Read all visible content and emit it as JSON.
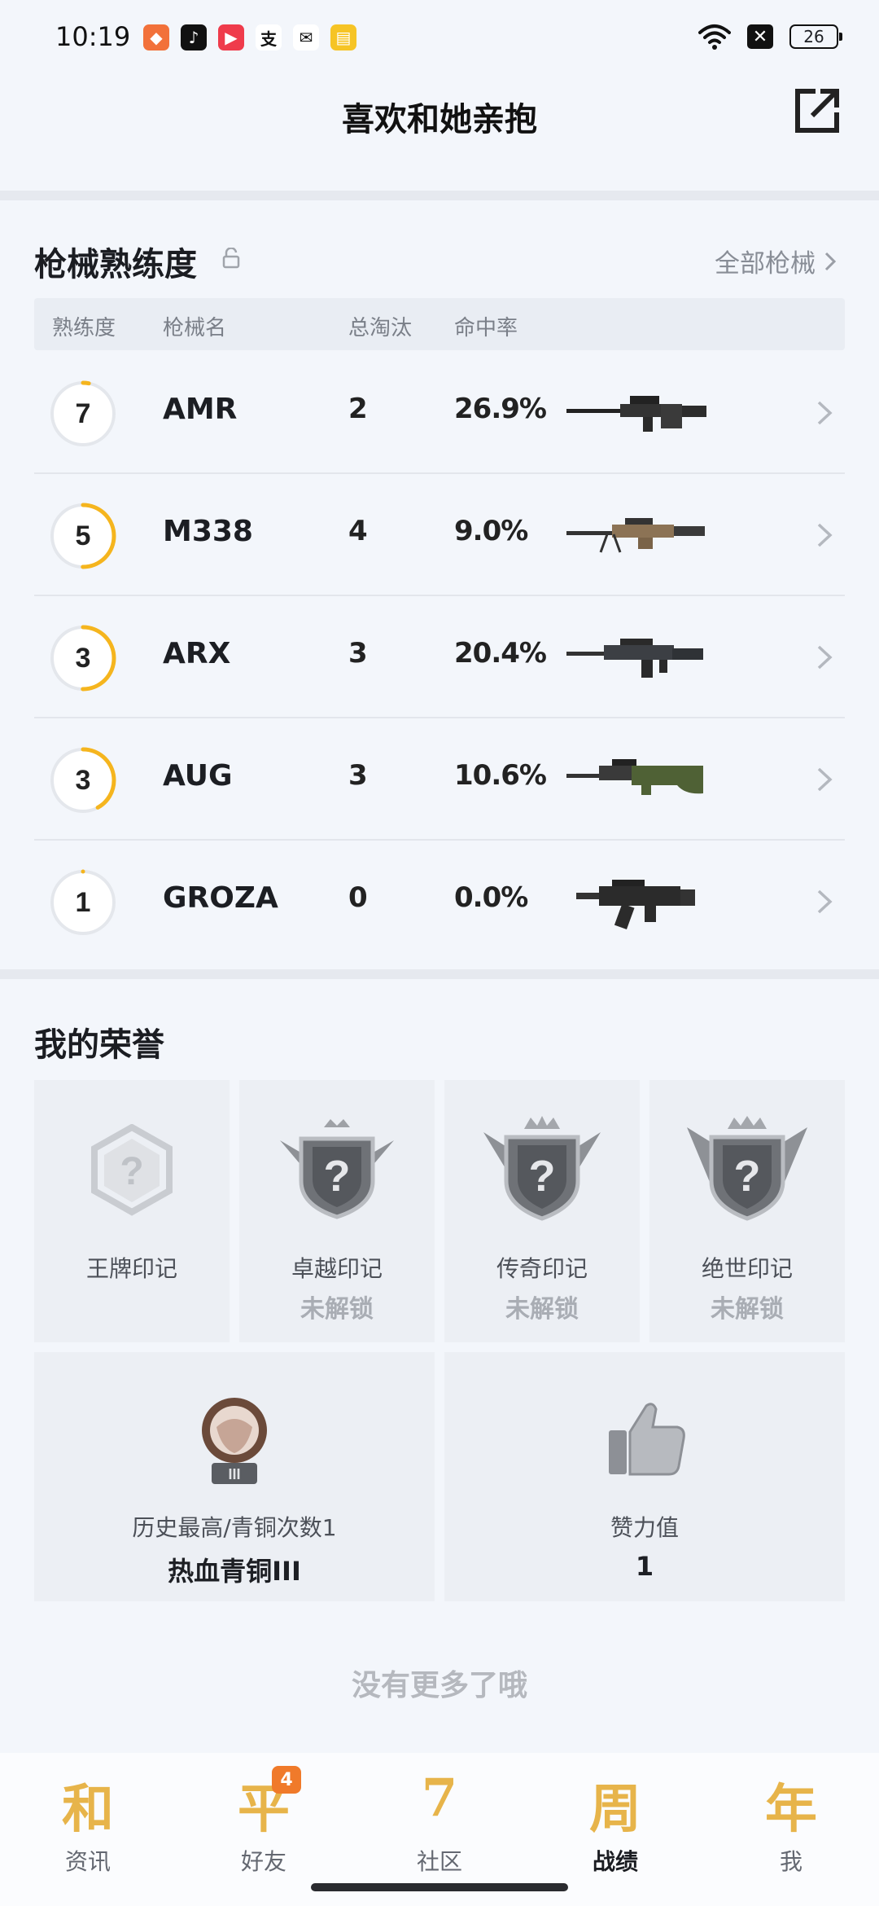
{
  "status_bar": {
    "time": "10:19",
    "apps": [
      {
        "icon": "game-app-icon",
        "color": "#f2713a",
        "glyph": "◆"
      },
      {
        "icon": "tiktok-icon",
        "color": "#111111",
        "glyph": "♪"
      },
      {
        "icon": "video-play-icon",
        "color": "#ef3b4b",
        "glyph": "▶"
      },
      {
        "icon": "alipay-icon",
        "color": "#ffffff",
        "glyph": "支"
      },
      {
        "icon": "wechat-icon",
        "color": "#ffffff",
        "glyph": "✉"
      },
      {
        "icon": "reader-app-icon",
        "color": "#f6c425",
        "glyph": "▤"
      }
    ],
    "battery": "26"
  },
  "header": {
    "title": "喜欢和她亲抱"
  },
  "weapons": {
    "section_title": "枪械熟练度",
    "all_link": "全部枪械",
    "columns": [
      "熟练度",
      "枪械名",
      "总淘汰",
      "命中率"
    ],
    "rows": [
      {
        "level": "7",
        "progress": 0.03,
        "name": "AMR",
        "eliminations": "2",
        "accuracy": "26.9%",
        "gun": "sniper"
      },
      {
        "level": "5",
        "progress": 0.5,
        "name": "M338",
        "eliminations": "4",
        "accuracy": "9.0%",
        "gun": "lmg"
      },
      {
        "level": "3",
        "progress": 0.5,
        "name": "ARX",
        "eliminations": "3",
        "accuracy": "20.4%",
        "gun": "rifle"
      },
      {
        "level": "3",
        "progress": 0.42,
        "name": "AUG",
        "eliminations": "3",
        "accuracy": "10.6%",
        "gun": "bullpup"
      },
      {
        "level": "1",
        "progress": 0.0,
        "name": "GROZA",
        "eliminations": "0",
        "accuracy": "0.0%",
        "gun": "groza"
      }
    ]
  },
  "honors": {
    "section_title": "我的荣誉",
    "marks": [
      {
        "label": "王牌印记",
        "sub": ""
      },
      {
        "label": "卓越印记",
        "sub": "未解锁"
      },
      {
        "label": "传奇印记",
        "sub": "未解锁"
      },
      {
        "label": "绝世印记",
        "sub": "未解锁"
      }
    ],
    "history": {
      "label": "历史最高/青铜次数1",
      "value": "热血青铜III"
    },
    "likes": {
      "label": "赞力值",
      "value": "1"
    }
  },
  "footer_text": "没有更多了哦",
  "nav": {
    "items": [
      {
        "glyph": "和",
        "label": "资讯",
        "active": false
      },
      {
        "glyph": "平",
        "label": "好友",
        "active": false,
        "badge": "4"
      },
      {
        "glyph": "7",
        "label": "社区",
        "active": false
      },
      {
        "glyph": "周",
        "label": "战绩",
        "active": true
      },
      {
        "glyph": "年",
        "label": "我",
        "active": false
      }
    ]
  },
  "colors": {
    "accent": "#f5b51e",
    "ring_track": "#e4e7ec",
    "badge": "#f07a2a"
  }
}
